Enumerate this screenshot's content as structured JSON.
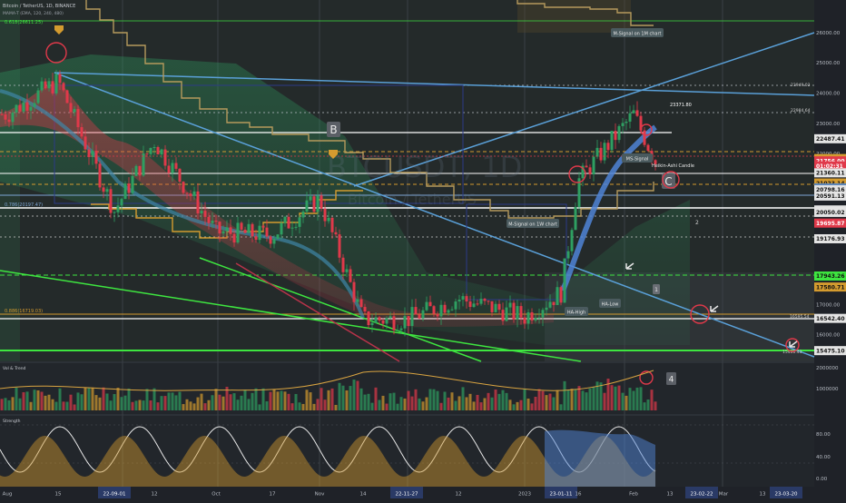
{
  "header": {
    "symbol_line": "Bitcoin / TetherUS, 1D, BINANCE",
    "ma_line": "MAMA-T (EMA, 120, 240, 480)"
  },
  "watermark": {
    "ticker": "BTCUSDT, 1D",
    "name": "Bitcoin / TetherUS"
  },
  "colors": {
    "background": "#1f2228",
    "red": "#e0394a",
    "green": "#2e9f61",
    "blue_line": "#5aa0d8",
    "lime_line": "#3ee640",
    "orange_line": "#d49b2f",
    "tan_line": "#b59a5c",
    "price_label": "#e4e4e4"
  },
  "annotations": {
    "fib_top": "0.618(26611.25)",
    "fib_mid": "0.786(20197.47)",
    "fib_bottom": "0.886(16719.03)",
    "level_23949": "23949.03",
    "level_23371": "23371.80",
    "level_22984": "22984.64",
    "level_16595": "16595.54",
    "level_15460": "15460.43",
    "callout_1m": "M-Signal on 1M chart",
    "callout_1w": "M-Signal on 1W chart",
    "callout_ms": "MS-Signal",
    "callout_heikin": "Heikin-Ashi Candle",
    "callout_ha_high": "HA-High",
    "callout_ha_low": "HA-Low",
    "wave_b": "B",
    "wave_c": "C",
    "wave_1": "1",
    "wave_2": "2",
    "vol_badge": "4",
    "vol_label": "Vol & Trend",
    "strength_label": "Strength"
  },
  "price_axis": {
    "ticks": [
      "26000.00",
      "25000.00",
      "24000.00",
      "23000.00",
      "22000.00",
      "17000.00",
      "16000.00"
    ],
    "labels": [
      {
        "text": "22487.41",
        "value": 22487.41,
        "bg": "#e4e4e4",
        "fg": "#111111"
      },
      {
        "text": "21833.06",
        "value": 21833.06,
        "bg": "#d49b2f",
        "fg": "#111111"
      },
      {
        "text": "21756.00",
        "value": 21756.0,
        "bg": "#e0394a",
        "fg": "#ffffff"
      },
      {
        "text": "01:02:31",
        "value": 21586.0,
        "bg": "#e0394a",
        "fg": "#ffffff"
      },
      {
        "text": "21360.11",
        "value": 21360.11,
        "bg": "#e4e4e4",
        "fg": "#111111"
      },
      {
        "text": "21023.14",
        "value": 21023.14,
        "bg": "#d49b2f",
        "fg": "#111111"
      },
      {
        "text": "20862.47",
        "value": 20862.47,
        "bg": "#5d86b8",
        "fg": "#ffffff"
      },
      {
        "text": "20798.16",
        "value": 20798.16,
        "bg": "#e4e4e4",
        "fg": "#111111"
      },
      {
        "text": "20591.13",
        "value": 20591.13,
        "bg": "#e4e4e4",
        "fg": "#111111"
      },
      {
        "text": "20131.46",
        "value": 20131.46,
        "bg": "#e4e4e4",
        "fg": "#111111"
      },
      {
        "text": "20050.02",
        "value": 20050.02,
        "bg": "#e4e4e4",
        "fg": "#111111"
      },
      {
        "text": "19695.87",
        "value": 19695.87,
        "bg": "#e0394a",
        "fg": "#ffffff"
      },
      {
        "text": "19176.93",
        "value": 19176.93,
        "bg": "#e4e4e4",
        "fg": "#111111"
      },
      {
        "text": "17943.26",
        "value": 17943.26,
        "bg": "#3ee640",
        "fg": "#111111"
      },
      {
        "text": "17580.71",
        "value": 17580.71,
        "bg": "#d49b2f",
        "fg": "#111111"
      },
      {
        "text": "16542.40",
        "value": 16542.4,
        "bg": "#e4e4e4",
        "fg": "#111111"
      },
      {
        "text": "15475.10",
        "value": 15475.1,
        "bg": "#e4e4e4",
        "fg": "#111111"
      }
    ]
  },
  "volume_axis": {
    "ticks": [
      "2000000",
      "1000000"
    ]
  },
  "strength_axis": {
    "ticks": [
      "80.00",
      "40.00",
      "0.00"
    ]
  },
  "time_axis": {
    "ticks": [
      "Aug",
      "15",
      "22-09-01",
      "12",
      "Oct",
      "17",
      "Nov",
      "14",
      "22-11-27",
      "12",
      "2023",
      "23-01-11",
      "16",
      "Feb",
      "13",
      "23-02-22",
      "Mar",
      "13",
      "23-03-20"
    ],
    "highlighted": [
      "22-09-01",
      "22-11-27",
      "23-01-11",
      "23-02-22",
      "23-03-20"
    ]
  },
  "chart_data": {
    "type": "candlestick",
    "title": "Bitcoin / TetherUS, 1D, BINANCE",
    "ylim": [
      15300,
      26900
    ],
    "x_start": "Aug",
    "x_end": "23-03-20",
    "grid": true,
    "horizontal_levels": [
      26611.25,
      23949.03,
      23371.8,
      22984.64,
      20197.47,
      16719.03,
      16595.54,
      15460.43
    ],
    "price_path": [
      {
        "x": "Aug",
        "close": 23300
      },
      {
        "x": "15",
        "close": 24400
      },
      {
        "x": "22-09-01",
        "close": 20100
      },
      {
        "x": "12",
        "close": 22400
      },
      {
        "x": "Oct",
        "close": 19400
      },
      {
        "x": "17",
        "close": 19300
      },
      {
        "x": "Nov",
        "close": 20500
      },
      {
        "x": "14",
        "close": 16500
      },
      {
        "x": "22-11-27",
        "close": 16500
      },
      {
        "x": "12",
        "close": 17200
      },
      {
        "x": "2023",
        "close": 16600
      },
      {
        "x": "23-01-11",
        "close": 17400
      },
      {
        "x": "16",
        "close": 21100
      },
      {
        "x": "Feb",
        "close": 23300
      },
      {
        "x": "13",
        "close": 21756
      }
    ],
    "current_price": 21756.0
  }
}
